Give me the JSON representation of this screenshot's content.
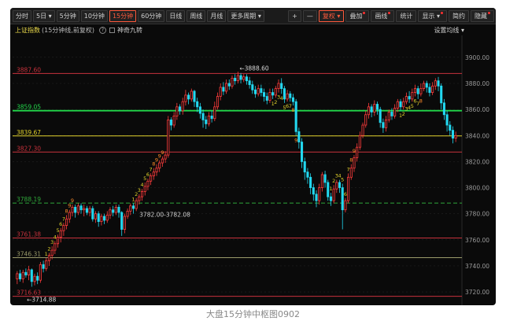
{
  "toolbar": {
    "buttons": [
      {
        "label": "分时",
        "active": false
      },
      {
        "label": "5日 ▾",
        "active": false
      },
      {
        "label": "5分钟",
        "active": false
      },
      {
        "label": "10分钟",
        "active": false
      },
      {
        "label": "15分钟",
        "active": true
      },
      {
        "label": "60分钟",
        "active": false
      },
      {
        "label": "日线",
        "active": false
      },
      {
        "label": "周线",
        "active": false
      },
      {
        "label": "月线",
        "active": false
      },
      {
        "label": "更多周期 ▾",
        "active": false
      }
    ],
    "right_buttons": [
      {
        "label": "+",
        "dot": false
      },
      {
        "label": "—",
        "dot": false
      },
      {
        "label": "复权 ▾",
        "dot": false,
        "active": true
      },
      {
        "label": "叠加",
        "dot": true
      },
      {
        "label": "画线",
        "dot": true
      },
      {
        "label": "统计",
        "dot": false
      },
      {
        "label": "显示 ▾",
        "dot": true
      },
      {
        "label": "简约",
        "dot": false
      },
      {
        "label": "隐藏",
        "dot": true
      }
    ]
  },
  "subbar": {
    "title": "上证指数",
    "period": "(15分钟线,前复权)",
    "help": "?",
    "indicator": "神奇九转",
    "settings": "设置均线 ▾"
  },
  "chart_data": {
    "type": "candlestick",
    "ylim": [
      3711,
      3915
    ],
    "y_ticks": [
      3720,
      3740,
      3760,
      3780,
      3800,
      3820,
      3840,
      3860,
      3880,
      3900
    ],
    "y_tick_labels": [
      "3720.00",
      "3740.00",
      "3760.00",
      "3780.00",
      "3800.00",
      "3820.00",
      "3840.00",
      "3860.00",
      "3880.00",
      "3900.00"
    ],
    "levels": [
      {
        "value": 3887.6,
        "label": "3887.60",
        "color": "#c8323c",
        "style": "solid"
      },
      {
        "value": 3859.05,
        "label": "3859.05",
        "color": "#22d84a",
        "style": "solid"
      },
      {
        "value": 3839.67,
        "label": "3839.67",
        "color": "#e2d22c",
        "style": "solid"
      },
      {
        "value": 3827.3,
        "label": "3827.30",
        "color": "#c8323c",
        "style": "solid"
      },
      {
        "value": 3788.19,
        "label": "3788.19",
        "color": "#2fa83a",
        "style": "dashed"
      },
      {
        "value": 3761.38,
        "label": "3761.38",
        "color": "#c8323c",
        "style": "solid"
      },
      {
        "value": 3746.31,
        "label": "3746.31",
        "color": "#9a9a6a",
        "style": "solid"
      },
      {
        "value": 3716.63,
        "label": "3716.63",
        "color": "#c8323c",
        "style": "solid"
      }
    ],
    "annotations": [
      {
        "text": "3888.60",
        "price": 3888.6
      },
      {
        "text": "3782.00-3782.08",
        "price": 3782.0
      },
      {
        "text": "3714.88",
        "price": 3714.88
      }
    ],
    "candles": [
      [
        3730,
        3734,
        3726,
        3736
      ],
      [
        3734,
        3730,
        3728,
        3737
      ],
      [
        3730,
        3735,
        3727,
        3737
      ],
      [
        3735,
        3733,
        3731,
        3738
      ],
      [
        3733,
        3737,
        3729,
        3740
      ],
      [
        3737,
        3728,
        3724,
        3738
      ],
      [
        3728,
        3732,
        3725,
        3734
      ],
      [
        3732,
        3729,
        3726,
        3735
      ],
      [
        3729,
        3741,
        3727,
        3743
      ],
      [
        3741,
        3738,
        3735,
        3744
      ],
      [
        3738,
        3744,
        3736,
        3746
      ],
      [
        3744,
        3748,
        3740,
        3750
      ],
      [
        3748,
        3752,
        3745,
        3755
      ],
      [
        3752,
        3757,
        3749,
        3759
      ],
      [
        3757,
        3762,
        3754,
        3764
      ],
      [
        3762,
        3767,
        3758,
        3769
      ],
      [
        3767,
        3771,
        3763,
        3773
      ],
      [
        3771,
        3776,
        3768,
        3779
      ],
      [
        3776,
        3781,
        3773,
        3783
      ],
      [
        3781,
        3785,
        3778,
        3787
      ],
      [
        3785,
        3781,
        3777,
        3787
      ],
      [
        3781,
        3786,
        3779,
        3788
      ],
      [
        3786,
        3783,
        3780,
        3788
      ],
      [
        3783,
        3784,
        3778,
        3787
      ],
      [
        3784,
        3781,
        3779,
        3786
      ],
      [
        3781,
        3784,
        3778,
        3786
      ],
      [
        3784,
        3776,
        3774,
        3786
      ],
      [
        3776,
        3780,
        3773,
        3782
      ],
      [
        3780,
        3774,
        3770,
        3782
      ],
      [
        3774,
        3778,
        3771,
        3780
      ],
      [
        3778,
        3775,
        3772,
        3780
      ],
      [
        3775,
        3779,
        3773,
        3782
      ],
      [
        3779,
        3783,
        3776,
        3785
      ],
      [
        3783,
        3781,
        3778,
        3786
      ],
      [
        3781,
        3785,
        3779,
        3787
      ],
      [
        3785,
        3781,
        3777,
        3787
      ],
      [
        3781,
        3768,
        3763,
        3782
      ],
      [
        3768,
        3778,
        3765,
        3780
      ],
      [
        3778,
        3782,
        3776,
        3784
      ],
      [
        3782,
        3786,
        3779,
        3788
      ],
      [
        3786,
        3784,
        3780,
        3788
      ],
      [
        3784,
        3790,
        3782,
        3792
      ],
      [
        3790,
        3793,
        3787,
        3795
      ],
      [
        3793,
        3797,
        3790,
        3799
      ],
      [
        3797,
        3801,
        3794,
        3804
      ],
      [
        3801,
        3805,
        3798,
        3807
      ],
      [
        3805,
        3809,
        3802,
        3811
      ],
      [
        3809,
        3812,
        3806,
        3815
      ],
      [
        3812,
        3815,
        3809,
        3818
      ],
      [
        3815,
        3819,
        3812,
        3821
      ],
      [
        3819,
        3822,
        3816,
        3824
      ],
      [
        3822,
        3825,
        3819,
        3828
      ],
      [
        3825,
        3852,
        3823,
        3855
      ],
      [
        3852,
        3848,
        3844,
        3854
      ],
      [
        3848,
        3855,
        3846,
        3858
      ],
      [
        3855,
        3862,
        3852,
        3865
      ],
      [
        3862,
        3859,
        3856,
        3864
      ],
      [
        3859,
        3866,
        3856,
        3869
      ],
      [
        3866,
        3871,
        3863,
        3875
      ],
      [
        3871,
        3868,
        3864,
        3873
      ],
      [
        3868,
        3874,
        3866,
        3876
      ],
      [
        3874,
        3866,
        3862,
        3875
      ],
      [
        3866,
        3862,
        3858,
        3869
      ],
      [
        3862,
        3857,
        3853,
        3865
      ],
      [
        3857,
        3852,
        3846,
        3860
      ],
      [
        3852,
        3849,
        3845,
        3855
      ],
      [
        3849,
        3855,
        3847,
        3858
      ],
      [
        3855,
        3853,
        3850,
        3859
      ],
      [
        3853,
        3862,
        3851,
        3866
      ],
      [
        3862,
        3870,
        3860,
        3873
      ],
      [
        3870,
        3877,
        3867,
        3880
      ],
      [
        3877,
        3874,
        3871,
        3881
      ],
      [
        3874,
        3880,
        3872,
        3883
      ],
      [
        3880,
        3878,
        3875,
        3883
      ],
      [
        3878,
        3884,
        3876,
        3886
      ],
      [
        3884,
        3882,
        3879,
        3887
      ],
      [
        3882,
        3886,
        3880,
        3889
      ],
      [
        3886,
        3883,
        3880,
        3888
      ],
      [
        3883,
        3885,
        3881,
        3887
      ],
      [
        3885,
        3882,
        3879,
        3887
      ],
      [
        3882,
        3879,
        3876,
        3885
      ],
      [
        3879,
        3875,
        3872,
        3882
      ],
      [
        3875,
        3872,
        3869,
        3878
      ],
      [
        3872,
        3876,
        3870,
        3879
      ],
      [
        3876,
        3873,
        3870,
        3879
      ],
      [
        3873,
        3870,
        3866,
        3876
      ],
      [
        3870,
        3867,
        3864,
        3873
      ],
      [
        3867,
        3873,
        3865,
        3876
      ],
      [
        3873,
        3871,
        3868,
        3876
      ],
      [
        3871,
        3876,
        3869,
        3878
      ],
      [
        3876,
        3880,
        3873,
        3883
      ],
      [
        3880,
        3876,
        3872,
        3884
      ],
      [
        3876,
        3868,
        3865,
        3878
      ],
      [
        3868,
        3872,
        3866,
        3875
      ],
      [
        3872,
        3869,
        3866,
        3874
      ],
      [
        3869,
        3866,
        3863,
        3872
      ],
      [
        3866,
        3843,
        3840,
        3868
      ],
      [
        3843,
        3835,
        3830,
        3846
      ],
      [
        3835,
        3820,
        3815,
        3838
      ],
      [
        3820,
        3812,
        3806,
        3823
      ],
      [
        3812,
        3808,
        3803,
        3815
      ],
      [
        3808,
        3800,
        3795,
        3811
      ],
      [
        3800,
        3795,
        3790,
        3803
      ],
      [
        3795,
        3790,
        3785,
        3798
      ],
      [
        3790,
        3800,
        3787,
        3803
      ],
      [
        3800,
        3810,
        3797,
        3812
      ],
      [
        3810,
        3804,
        3800,
        3813
      ],
      [
        3804,
        3793,
        3790,
        3806
      ],
      [
        3793,
        3790,
        3786,
        3796
      ],
      [
        3790,
        3799,
        3788,
        3802
      ],
      [
        3799,
        3804,
        3796,
        3806
      ],
      [
        3804,
        3800,
        3796,
        3806
      ],
      [
        3800,
        3783,
        3768,
        3803
      ],
      [
        3783,
        3790,
        3781,
        3792
      ],
      [
        3790,
        3808,
        3788,
        3811
      ],
      [
        3808,
        3815,
        3806,
        3818
      ],
      [
        3815,
        3823,
        3812,
        3825
      ],
      [
        3823,
        3831,
        3820,
        3834
      ],
      [
        3831,
        3840,
        3829,
        3843
      ],
      [
        3840,
        3848,
        3838,
        3850
      ],
      [
        3848,
        3856,
        3846,
        3859
      ],
      [
        3856,
        3862,
        3853,
        3865
      ],
      [
        3862,
        3858,
        3854,
        3864
      ],
      [
        3858,
        3864,
        3855,
        3867
      ],
      [
        3864,
        3860,
        3856,
        3866
      ],
      [
        3860,
        3850,
        3846,
        3862
      ],
      [
        3850,
        3846,
        3842,
        3853
      ],
      [
        3846,
        3852,
        3843,
        3855
      ],
      [
        3852,
        3858,
        3850,
        3860
      ],
      [
        3858,
        3855,
        3852,
        3861
      ],
      [
        3855,
        3861,
        3853,
        3864
      ],
      [
        3861,
        3866,
        3858,
        3868
      ],
      [
        3866,
        3862,
        3859,
        3868
      ],
      [
        3862,
        3866,
        3860,
        3869
      ],
      [
        3866,
        3870,
        3864,
        3873
      ],
      [
        3870,
        3868,
        3865,
        3874
      ],
      [
        3868,
        3873,
        3866,
        3876
      ],
      [
        3873,
        3876,
        3870,
        3879
      ],
      [
        3876,
        3872,
        3868,
        3878
      ],
      [
        3872,
        3876,
        3870,
        3880
      ],
      [
        3876,
        3880,
        3874,
        3882
      ],
      [
        3880,
        3877,
        3873,
        3882
      ],
      [
        3877,
        3873,
        3870,
        3880
      ],
      [
        3873,
        3878,
        3871,
        3881
      ],
      [
        3878,
        3882,
        3875,
        3884
      ],
      [
        3882,
        3878,
        3874,
        3885
      ],
      [
        3878,
        3865,
        3860,
        3880
      ],
      [
        3865,
        3856,
        3852,
        3868
      ],
      [
        3856,
        3848,
        3843,
        3859
      ],
      [
        3848,
        3844,
        3840,
        3851
      ],
      [
        3844,
        3838,
        3834,
        3847
      ],
      [
        3838,
        3840,
        3835,
        3843
      ]
    ]
  },
  "caption": "大盘15分钟中枢图0902"
}
